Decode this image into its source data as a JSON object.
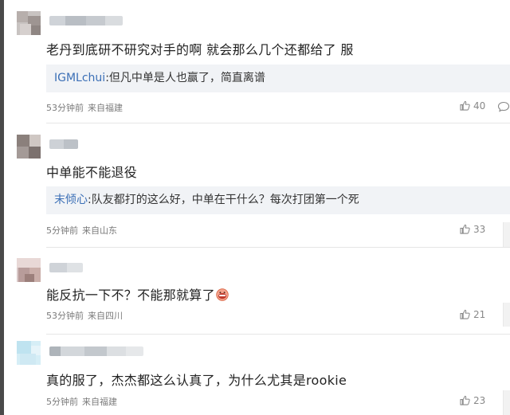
{
  "comments": [
    {
      "text": "老丹到底研不研究对手的啊 就会那么几个还都给了 服",
      "quote_user": "IGMLchui",
      "quote_text": ":但凡中单是人也赢了，简直离谱",
      "time": "53分钟前",
      "location": "来自福建",
      "likes": "40"
    },
    {
      "text": "中单能不能退役",
      "quote_user": "末倾心",
      "quote_text": ":队友都打的这么好，中单在干什么？每次打团第一个死",
      "time": "5分钟前",
      "location": "来自山东",
      "likes": "33"
    },
    {
      "text": "能反抗一下不？不能那就算了",
      "emoji": "grinning-face-emoji",
      "time": "53分钟前",
      "location": "来自四川",
      "likes": "21"
    },
    {
      "text": "真的服了，杰杰都这么认真了，为什么尤其是rookie",
      "time": "5分钟前",
      "location": "来自福建",
      "likes": "23"
    }
  ],
  "icons": {
    "like": "thumbs-up-icon",
    "reply": "comment-bubble-icon"
  },
  "colors": {
    "quote_user": "#3b6fb6",
    "quote_background": "#f1f3f6",
    "meta": "#7a7a7a"
  }
}
